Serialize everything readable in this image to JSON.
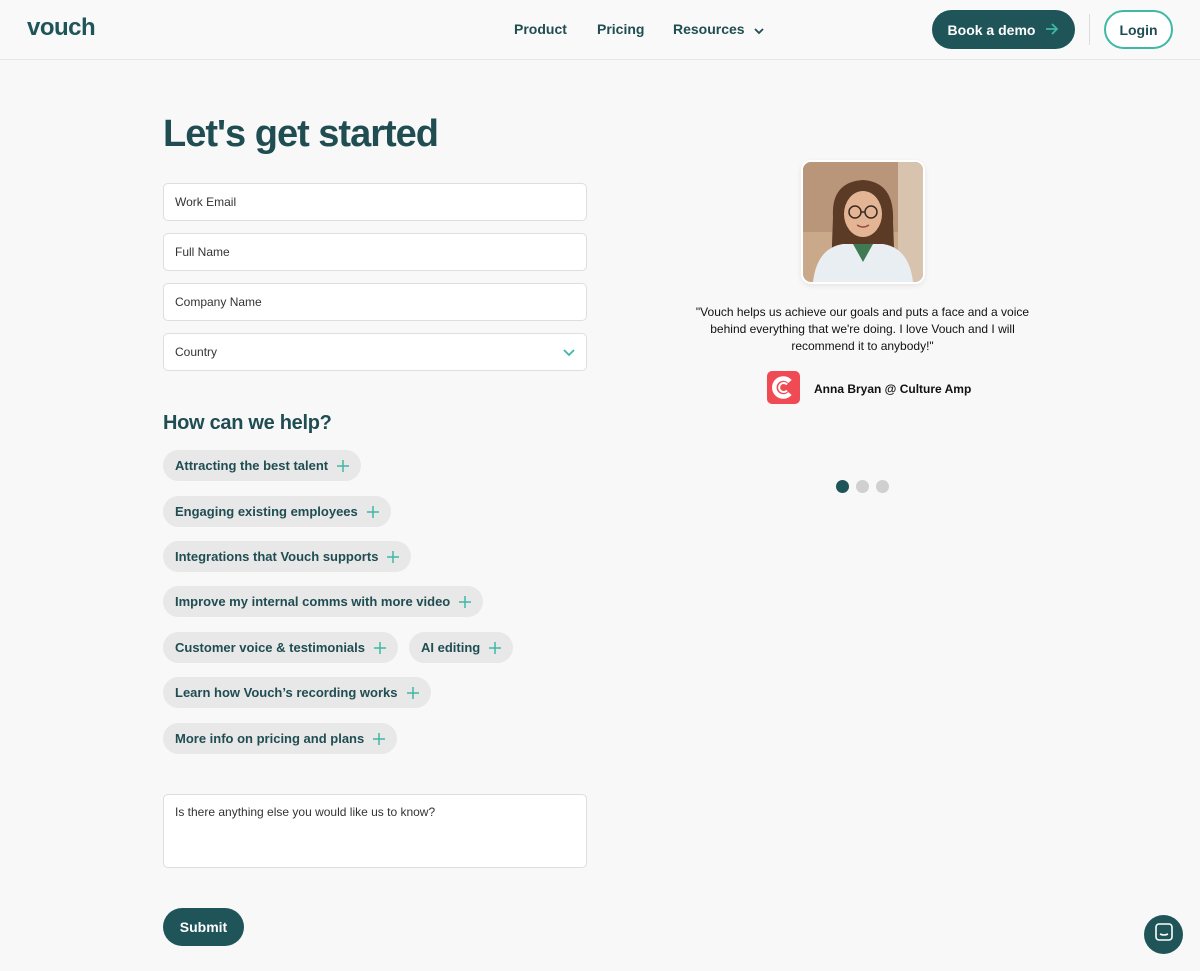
{
  "header": {
    "logo": "vouch",
    "nav": [
      {
        "label": "Product"
      },
      {
        "label": "Pricing"
      },
      {
        "label": "Resources"
      }
    ],
    "book_demo_label": "Book a demo",
    "login_label": "Login"
  },
  "form": {
    "title": "Let's get started",
    "fields": {
      "email": "Work Email",
      "name": "Full Name",
      "company": "Company Name",
      "country": "Country"
    },
    "help_title": "How can we help?",
    "chips": [
      "Attracting the best talent",
      "Engaging existing employees",
      "Integrations that Vouch supports",
      "Improve my internal comms with more video",
      "Customer voice & testimonials",
      "AI editing",
      "Learn how Vouch’s recording works",
      "More info on pricing and plans"
    ],
    "textarea_placeholder": "Is there anything else you would like us to know?",
    "submit_label": "Submit"
  },
  "testimonial": {
    "quote": "\"Vouch helps us achieve our goals and puts a face and a voice behind everything that we're doing. I love Vouch and I will recommend it to anybody!\"",
    "author": "Anna Bryan @ Culture Amp",
    "active_slide": 1,
    "slide_count": 3
  },
  "colors": {
    "brand": "#1f5459",
    "accent": "#3fb8a6",
    "chip_bg": "#e8e8e8",
    "culture_amp": "#f04a54"
  },
  "icons": [
    "chevron-down-icon",
    "arrow-right-icon",
    "plus-icon",
    "chat-icon"
  ]
}
